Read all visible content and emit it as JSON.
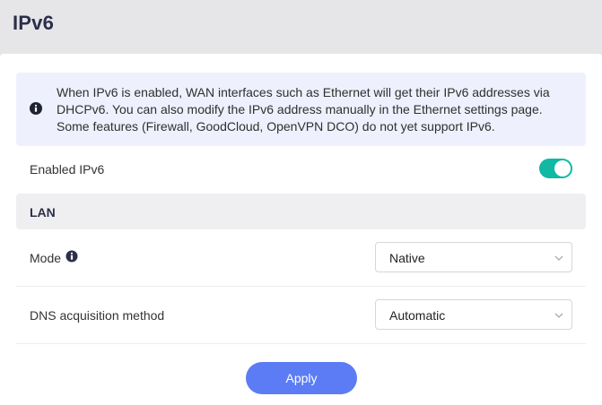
{
  "header": {
    "title": "IPv6"
  },
  "info": {
    "icon": "info-icon",
    "text": "When IPv6 is enabled, WAN interfaces such as Ethernet will get their IPv6 addresses via DHCPv6. You can also modify the IPv6 address manually in the Ethernet settings page. Some features (Firewall, GoodCloud, OpenVPN DCO) do not yet support IPv6."
  },
  "enabled": {
    "label": "Enabled IPv6",
    "on": true,
    "color": "#11b8a3"
  },
  "lan": {
    "section_title": "LAN",
    "mode": {
      "label": "Mode",
      "icon": "info-icon",
      "value": "Native"
    },
    "dns": {
      "label": "DNS acquisition method",
      "value": "Automatic"
    }
  },
  "actions": {
    "apply_label": "Apply",
    "color": "#5b7cf5"
  }
}
